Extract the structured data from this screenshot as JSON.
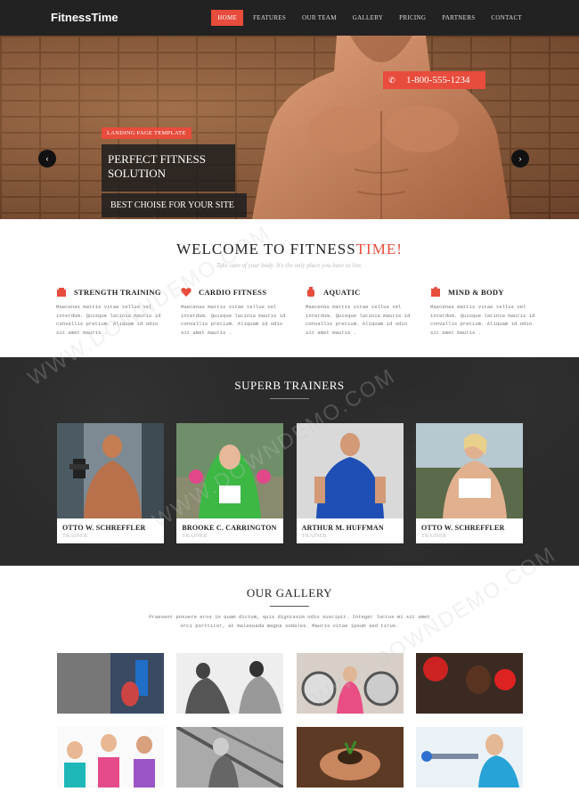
{
  "nav": {
    "logo": "FitnessTime",
    "items": [
      "HOME",
      "FEATURES",
      "OUR TEAM",
      "GALLERY",
      "PRICING",
      "PARTNERS",
      "CONTACT"
    ],
    "active_index": 0
  },
  "hero": {
    "phone": "1-800-555-1234",
    "phone_icon": "phone-icon",
    "tag": "LANDING PAGE TEMPLATE",
    "title": "PERFECT FITNESS SOLUTION",
    "subtitle": "BEST CHOISE FOR YOUR SITE",
    "prev_icon": "‹",
    "next_icon": "›"
  },
  "welcome": {
    "title_main": "WELCOME TO FITNESS",
    "title_accent": "TIME!",
    "subtitle": "Take care of your body. It's the only place you have to live."
  },
  "features": [
    {
      "icon": "dumbbell-icon",
      "title": "STRENGTH TRAINING",
      "text": "Maecenas mattis vitae tellus vel interdum. Quisque lacinia mauris id convallis pretium. Aliquam id odio sit amet mauris ."
    },
    {
      "icon": "heart-icon",
      "title": "CARDIO FITNESS",
      "text": "Maecenas mattis vitae tellus vel interdum. Quisque lacinia mauris id convallis pretium. Aliquam id odio sit amet mauris ."
    },
    {
      "icon": "kettlebell-icon",
      "title": "AQUATIC",
      "text": "Maecenas mattis vitae tellus vel interdum. Quisque lacinia mauris id convallis pretium. Aliquam id odio sit amet mauris ."
    },
    {
      "icon": "body-icon",
      "title": "MIND & BODY",
      "text": "Maecenas mattis vitae tellus vel interdum. Quisque lacinia mauris id convallis pretium. Aliquam id odio sit amet mauris ."
    }
  ],
  "trainers": {
    "title": "SUPERB TRAINERS",
    "items": [
      {
        "name": "OTTO W. SCHREFFLER",
        "role": "TRAINER"
      },
      {
        "name": "BROOKE C. CARRINGTON",
        "role": "TRAINER"
      },
      {
        "name": "ARTHUR M. HUFFMAN",
        "role": "TRAINER"
      },
      {
        "name": "OTTO W. SCHREFFLER",
        "role": "TRAINER"
      }
    ]
  },
  "gallery": {
    "title": "OUR GALLERY",
    "description": "Praesent posuere eros in quam dictum, quis dignissim odio suscipit. Integer luctus mi sit amet orci porttitor, at malesuada magna sodales. Mauris vitae ipsum sed tirus."
  },
  "watermark": "WWW.DOWNDEMO.COM",
  "colors": {
    "accent": "#e74c3c",
    "dark": "#222222",
    "trainer_bg": "#2b2b2b"
  }
}
